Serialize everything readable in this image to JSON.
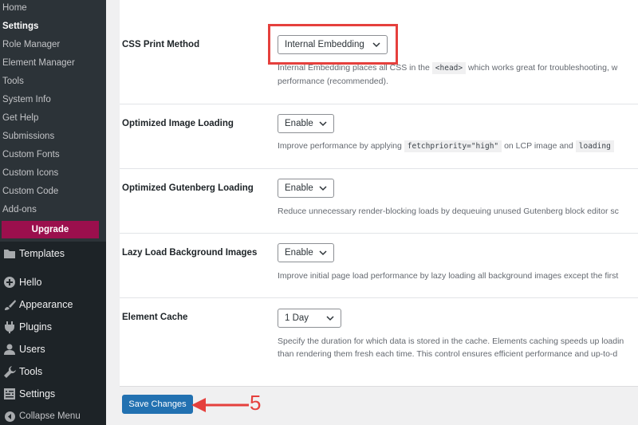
{
  "sidebar": {
    "submenu": [
      "Home",
      "Settings",
      "Role Manager",
      "Element Manager",
      "Tools",
      "System Info",
      "Get Help",
      "Submissions",
      "Custom Fonts",
      "Custom Icons",
      "Custom Code",
      "Add-ons"
    ],
    "current": "Settings",
    "upgrade_label": "Upgrade",
    "menu": {
      "templates": "Templates",
      "hello": "Hello",
      "appearance": "Appearance",
      "plugins": "Plugins",
      "users": "Users",
      "tools": "Tools",
      "settings": "Settings",
      "collapse": "Collapse Menu"
    }
  },
  "settings": {
    "css_print": {
      "label": "CSS Print Method",
      "value": "Internal Embedding",
      "desc_1a": "Internal Embedding places all CSS in the",
      "desc_code": "<head>",
      "desc_1b": "which works great for troubleshooting, w",
      "desc_2": "performance (recommended)."
    },
    "image_loading": {
      "label": "Optimized Image Loading",
      "value": "Enable",
      "desc_a": "Improve performance by applying",
      "desc_code1": "fetchpriority=\"high\"",
      "desc_b": "on LCP image and",
      "desc_code2": "loading"
    },
    "gutenberg": {
      "label": "Optimized Gutenberg Loading",
      "value": "Enable",
      "desc": "Reduce unnecessary render-blocking loads by dequeuing unused Gutenberg block editor sc"
    },
    "lazy_bg": {
      "label": "Lazy Load Background Images",
      "value": "Enable",
      "desc": "Improve initial page load performance by lazy loading all background images except the first"
    },
    "element_cache": {
      "label": "Element Cache",
      "value": "1 Day",
      "desc_1": "Specify the duration for which data is stored in the cache. Elements caching speeds up loadin",
      "desc_2": "than rendering them fresh each time. This control ensures efficient performance and up-to-d"
    }
  },
  "save_label": "Save Changes",
  "annotation": {
    "step_number": "5",
    "color": "#e5403d"
  }
}
